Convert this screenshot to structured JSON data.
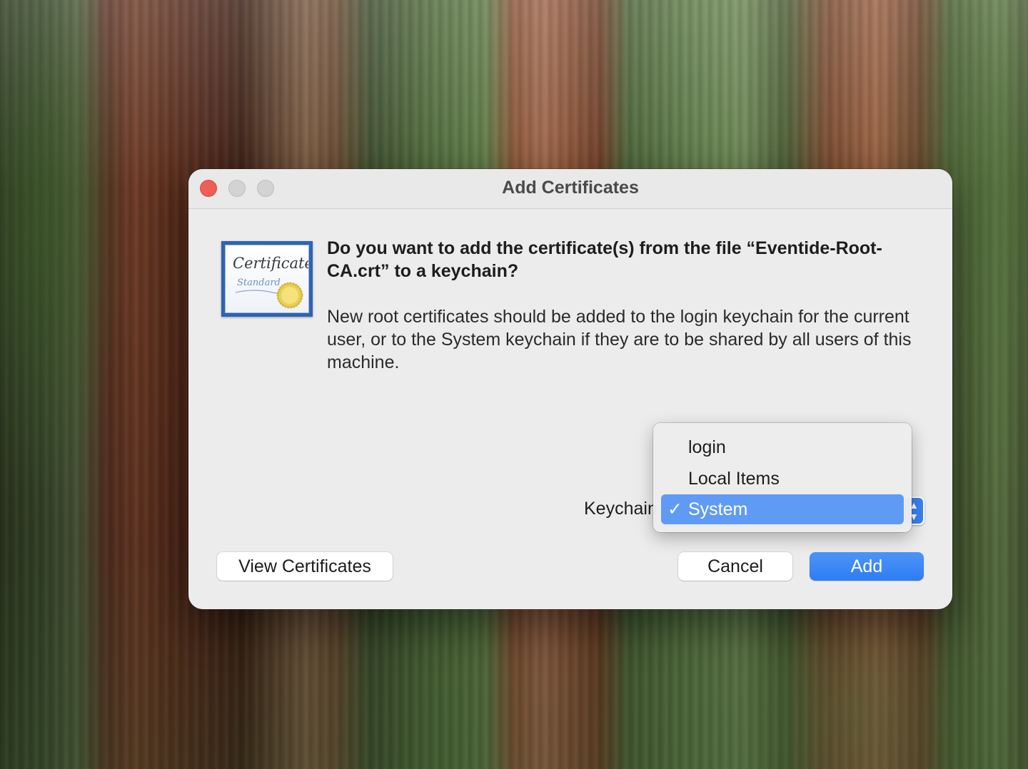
{
  "dialog": {
    "title": "Add Certificates",
    "heading": "Do you want to add the certificate(s) from the file “Eventide-Root-CA.crt” to a keychain?",
    "body": "New root certificates should be added to the login keychain for the current user, or to the System keychain if they are to be shared by all users of this machine.",
    "certificate_icon": {
      "line1": "Certificate",
      "line2": "Standard"
    },
    "keychain": {
      "label": "Keychain:",
      "selected": "System",
      "options": [
        "login",
        "Local Items",
        "System"
      ],
      "check_mark": "✓"
    },
    "buttons": {
      "view_certificates": "View Certificates",
      "cancel": "Cancel",
      "add": "Add"
    }
  },
  "colors": {
    "accent": "#2f7cf3",
    "menu_highlight": "#5f9bf4",
    "close": "#ee5f57",
    "inactive_traffic": "#d3d3d3",
    "dialog_bg": "#ececec"
  },
  "icons": {
    "close": "close-button",
    "minimize": "minimize-button",
    "zoom": "zoom-button",
    "certificate": "certificate-icon",
    "popup_arrows": "chevron-up-down-icon",
    "checkmark": "checkmark-icon"
  }
}
